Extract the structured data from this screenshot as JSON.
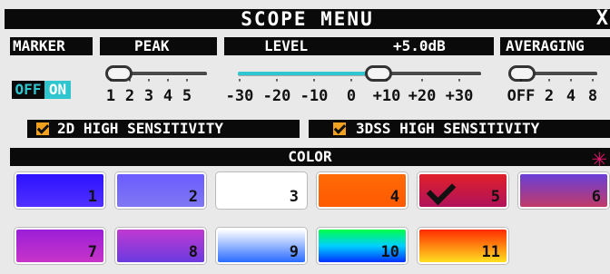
{
  "window": {
    "title": "SCOPE MENU",
    "close": "X"
  },
  "marker": {
    "label": "MARKER",
    "off": "OFF",
    "on": "ON"
  },
  "peak": {
    "label": "PEAK",
    "ticks": [
      "1",
      "2",
      "3",
      "4",
      "5"
    ]
  },
  "level": {
    "label": "LEVEL",
    "value": "+5.0dB",
    "ticks": [
      "-30",
      "-20",
      "-10",
      "0",
      "+10",
      "+20",
      "+30"
    ]
  },
  "averaging": {
    "label": "AVERAGING",
    "ticks": [
      "OFF",
      "2",
      "4",
      "8"
    ]
  },
  "sensitivity": {
    "hs2d": "2D HIGH SENSITIVITY",
    "hs3dss": "3DSS HIGH SENSITIVITY"
  },
  "color": {
    "label": "COLOR",
    "selected": "5",
    "swatches": [
      {
        "num": "1",
        "bg": "linear-gradient(#2d12ff,#5030ff)"
      },
      {
        "num": "2",
        "bg": "linear-gradient(#6a5cff,#7f78f2)"
      },
      {
        "num": "3",
        "bg": "#ffffff"
      },
      {
        "num": "4",
        "bg": "linear-gradient(#ff6a06,#ff5a00)"
      },
      {
        "num": "5",
        "bg": "linear-gradient(#e0202a,#b0125a)"
      },
      {
        "num": "6",
        "bg": "linear-gradient(#6a3fd8,#c23a68)"
      },
      {
        "num": "7",
        "bg": "linear-gradient(#9a1fd8,#c834c8)"
      },
      {
        "num": "8",
        "bg": "linear-gradient(#c03ad0,#6a3ae0)"
      },
      {
        "num": "9",
        "bg": "linear-gradient(#ffffff,#2a6bff)"
      },
      {
        "num": "10",
        "bg": "linear-gradient(#00ff4a,#00d0ff,#0030ff)"
      },
      {
        "num": "11",
        "bg": "linear-gradient(#ff2a00,#ffe020)"
      }
    ]
  }
}
